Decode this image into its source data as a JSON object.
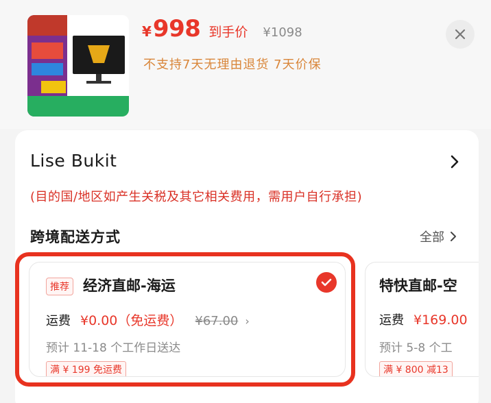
{
  "product": {
    "image_name": "monitor-product-image",
    "price_currency": "¥",
    "price_value": "998",
    "price_tag": "到手价",
    "original_price": "¥1098",
    "return_notice": "不支持7天无理由退货  7天价保"
  },
  "address": {
    "name": "Lise  Bukit",
    "tax_notice": "(目的国/地区如产生关税及其它相关费用，需用户自行承担)"
  },
  "shipping": {
    "section_title": "跨境配送方式",
    "all_label": "全部",
    "options": [
      {
        "badge": "推荐",
        "title": "经济直邮-海运",
        "fee_label": "运费",
        "fee_value": "¥0.00（免运费）",
        "fee_original": "¥67.00",
        "eta": "预计 11-18 个工作日送达",
        "promo": "满 ¥ 199 免运费",
        "selected": true
      },
      {
        "title": "特快直邮-空",
        "fee_label": "运费",
        "fee_value": "¥169.00",
        "eta": "预计 5-8 个工",
        "promo": "满 ¥ 800 减13",
        "selected": false
      }
    ]
  },
  "colors": {
    "accent_red": "#e8372a",
    "highlight_red": "#e8321f",
    "notice_orange": "#d9863a"
  }
}
